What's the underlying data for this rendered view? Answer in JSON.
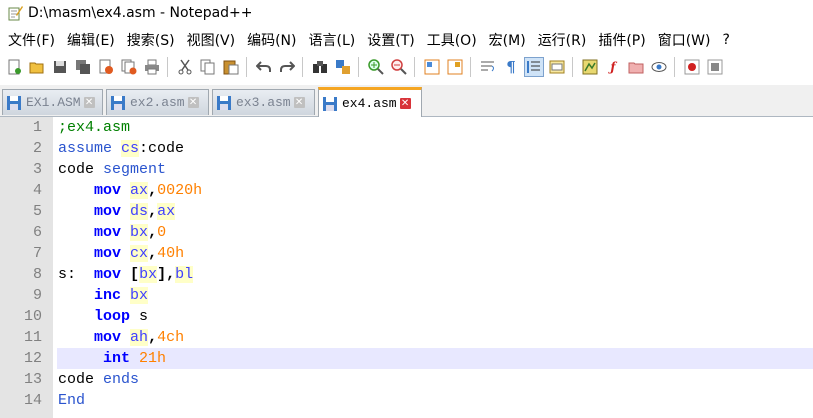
{
  "window": {
    "title": "D:\\masm\\ex4.asm - Notepad++"
  },
  "menu": [
    "文件(F)",
    "编辑(E)",
    "搜索(S)",
    "视图(V)",
    "编码(N)",
    "语言(L)",
    "设置(T)",
    "工具(O)",
    "宏(M)",
    "运行(R)",
    "插件(P)",
    "窗口(W)",
    "?"
  ],
  "toolbar": {
    "icons": [
      "new-file-icon",
      "open-file-icon",
      "save-icon",
      "save-all-icon",
      "close-icon",
      "close-all-icon",
      "print-icon",
      "cut-icon",
      "copy-icon",
      "paste-icon",
      "undo-icon",
      "redo-icon",
      "find-icon",
      "replace-icon",
      "zoom-in-icon",
      "zoom-out-icon",
      "sync-vertical-icon",
      "sync-horizontal-icon",
      "word-wrap-icon",
      "show-all-chars-icon",
      "indent-guide-icon",
      "doc-map-icon",
      "function-list-icon",
      "folder-workspace-icon",
      "monitor-icon",
      "record-macro-icon",
      "stop-record-icon"
    ]
  },
  "tabs": [
    {
      "label": "EX1.ASM",
      "active": false
    },
    {
      "label": "ex2.asm",
      "active": false
    },
    {
      "label": "ex3.asm",
      "active": false
    },
    {
      "label": "ex4.asm",
      "active": true
    }
  ],
  "editor": {
    "current_line": 12,
    "lines": [
      {
        "n": "1",
        "tokens": [
          {
            "t": ";ex4.asm",
            "c": "com"
          }
        ]
      },
      {
        "n": "2",
        "tokens": [
          {
            "t": "assume ",
            "c": "dir"
          },
          {
            "t": "cs",
            "c": "reg"
          },
          {
            "t": ":code",
            "c": "def"
          }
        ]
      },
      {
        "n": "3",
        "tokens": [
          {
            "t": "code ",
            "c": "def"
          },
          {
            "t": "segment",
            "c": "dir"
          }
        ]
      },
      {
        "n": "4",
        "tokens": [
          {
            "t": "    ",
            "c": "def"
          },
          {
            "t": "mov",
            "c": "ins"
          },
          {
            "t": " ",
            "c": "def"
          },
          {
            "t": "ax",
            "c": "reg"
          },
          {
            "t": ",",
            "c": "op"
          },
          {
            "t": "0020h",
            "c": "num"
          }
        ]
      },
      {
        "n": "5",
        "tokens": [
          {
            "t": "    ",
            "c": "def"
          },
          {
            "t": "mov",
            "c": "ins"
          },
          {
            "t": " ",
            "c": "def"
          },
          {
            "t": "ds",
            "c": "reg"
          },
          {
            "t": ",",
            "c": "op"
          },
          {
            "t": "ax",
            "c": "reg"
          }
        ]
      },
      {
        "n": "6",
        "tokens": [
          {
            "t": "    ",
            "c": "def"
          },
          {
            "t": "mov",
            "c": "ins"
          },
          {
            "t": " ",
            "c": "def"
          },
          {
            "t": "bx",
            "c": "reg"
          },
          {
            "t": ",",
            "c": "op"
          },
          {
            "t": "0",
            "c": "num"
          }
        ]
      },
      {
        "n": "7",
        "tokens": [
          {
            "t": "    ",
            "c": "def"
          },
          {
            "t": "mov",
            "c": "ins"
          },
          {
            "t": " ",
            "c": "def"
          },
          {
            "t": "cx",
            "c": "reg"
          },
          {
            "t": ",",
            "c": "op"
          },
          {
            "t": "40h",
            "c": "num"
          }
        ]
      },
      {
        "n": "8",
        "tokens": [
          {
            "t": "s:  ",
            "c": "def"
          },
          {
            "t": "mov",
            "c": "ins"
          },
          {
            "t": " ",
            "c": "def"
          },
          {
            "t": "[",
            "c": "op"
          },
          {
            "t": "bx",
            "c": "reg"
          },
          {
            "t": "],",
            "c": "op"
          },
          {
            "t": "bl",
            "c": "reg"
          }
        ]
      },
      {
        "n": "9",
        "tokens": [
          {
            "t": "    ",
            "c": "def"
          },
          {
            "t": "inc",
            "c": "ins"
          },
          {
            "t": " ",
            "c": "def"
          },
          {
            "t": "bx",
            "c": "reg"
          }
        ]
      },
      {
        "n": "10",
        "tokens": [
          {
            "t": "    ",
            "c": "def"
          },
          {
            "t": "loop",
            "c": "ins"
          },
          {
            "t": " s",
            "c": "def"
          }
        ]
      },
      {
        "n": "11",
        "tokens": [
          {
            "t": "    ",
            "c": "def"
          },
          {
            "t": "mov",
            "c": "ins"
          },
          {
            "t": " ",
            "c": "def"
          },
          {
            "t": "ah",
            "c": "reg"
          },
          {
            "t": ",",
            "c": "op"
          },
          {
            "t": "4ch",
            "c": "num"
          }
        ]
      },
      {
        "n": "12",
        "tokens": [
          {
            "t": "     ",
            "c": "def"
          },
          {
            "t": "int",
            "c": "ins"
          },
          {
            "t": " ",
            "c": "def"
          },
          {
            "t": "21h",
            "c": "num"
          }
        ]
      },
      {
        "n": "13",
        "tokens": [
          {
            "t": "code ",
            "c": "def"
          },
          {
            "t": "ends",
            "c": "dir"
          }
        ]
      },
      {
        "n": "14",
        "tokens": [
          {
            "t": "End",
            "c": "dir"
          }
        ]
      }
    ]
  }
}
